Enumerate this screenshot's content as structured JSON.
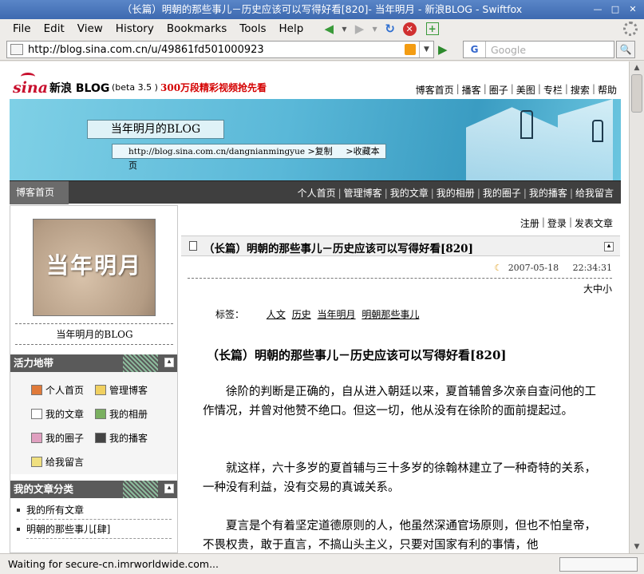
{
  "window": {
    "title": "（长篇）明朝的那些事儿－历史应该可以写得好看[820]- 当年明月 - 新浪BLOG - Swiftfox"
  },
  "menu": [
    "File",
    "Edit",
    "View",
    "History",
    "Bookmarks",
    "Tools",
    "Help"
  ],
  "address": {
    "url": "http://blog.sina.com.cn/u/49861fd501000923"
  },
  "search": {
    "engine": "G",
    "placeholder": "Google"
  },
  "site": {
    "logo": "sina",
    "brand": "新浪 BLOG",
    "beta": "(beta 3.5 )",
    "promo": "300万段精彩视频抢先看",
    "toplinks": [
      "博客首页",
      "播客",
      "圈子",
      "美图",
      "专栏",
      "搜索",
      "帮助"
    ]
  },
  "banner": {
    "blog_title": "当年明月的",
    "blog_title_en": "BLOG",
    "blog_url": "http://blog.sina.com.cn/dangnianmingyue",
    "copy": ">复制",
    "fav": ">收藏本页"
  },
  "nav": {
    "home": "博客首页",
    "links": [
      "个人首页",
      "管理博客",
      "我的文章",
      "我的相册",
      "我的圈子",
      "我的播客",
      "给我留言"
    ]
  },
  "sidebar": {
    "avatar_text": "当年明月",
    "name": "当年明月的",
    "name_en": "BLOG",
    "functions_title": "活力地带",
    "functions": [
      "个人首页",
      "管理博客",
      "我的文章",
      "我的相册",
      "我的圈子",
      "我的播客",
      "给我留言"
    ],
    "categories_title": "我的文章分类",
    "categories": [
      "我的所有文章",
      "明朝的那些事儿[肆]"
    ]
  },
  "main": {
    "actions": [
      "注册",
      "登录",
      "发表文章"
    ],
    "header_title": "（长篇）明朝的那些事儿－历史应该可以写得好看",
    "header_num": "[820]",
    "date": "2007-05-18",
    "time": "22:34:31",
    "fontsize": "大中小",
    "tags_label": "标签：",
    "tags": [
      "人文",
      "历史",
      "当年明月",
      "明朝那些事儿"
    ],
    "title": "（长篇）明朝的那些事儿－历史应该可以写得好看",
    "title_num": "[820]",
    "paragraphs": [
      "徐阶的判断是正确的，自从进入朝廷以来，夏首辅曾多次亲自查问他的工作情况，并曾对他赞不绝口。但这一切，他从没有在徐阶的面前提起过。",
      "就这样，六十多岁的夏首辅与三十多岁的徐翰林建立了一种奇特的关系，一种没有利益，没有交易的真诚关系。",
      "夏言是个有着坚定道德原则的人，他虽然深通官场原则，但也不怕皇帝，不畏权贵，敢于直言，不搞山头主义，只要对国家有利的事情，他"
    ]
  },
  "status": {
    "text": "Waiting for secure-cn.imrworldwide.com..."
  }
}
